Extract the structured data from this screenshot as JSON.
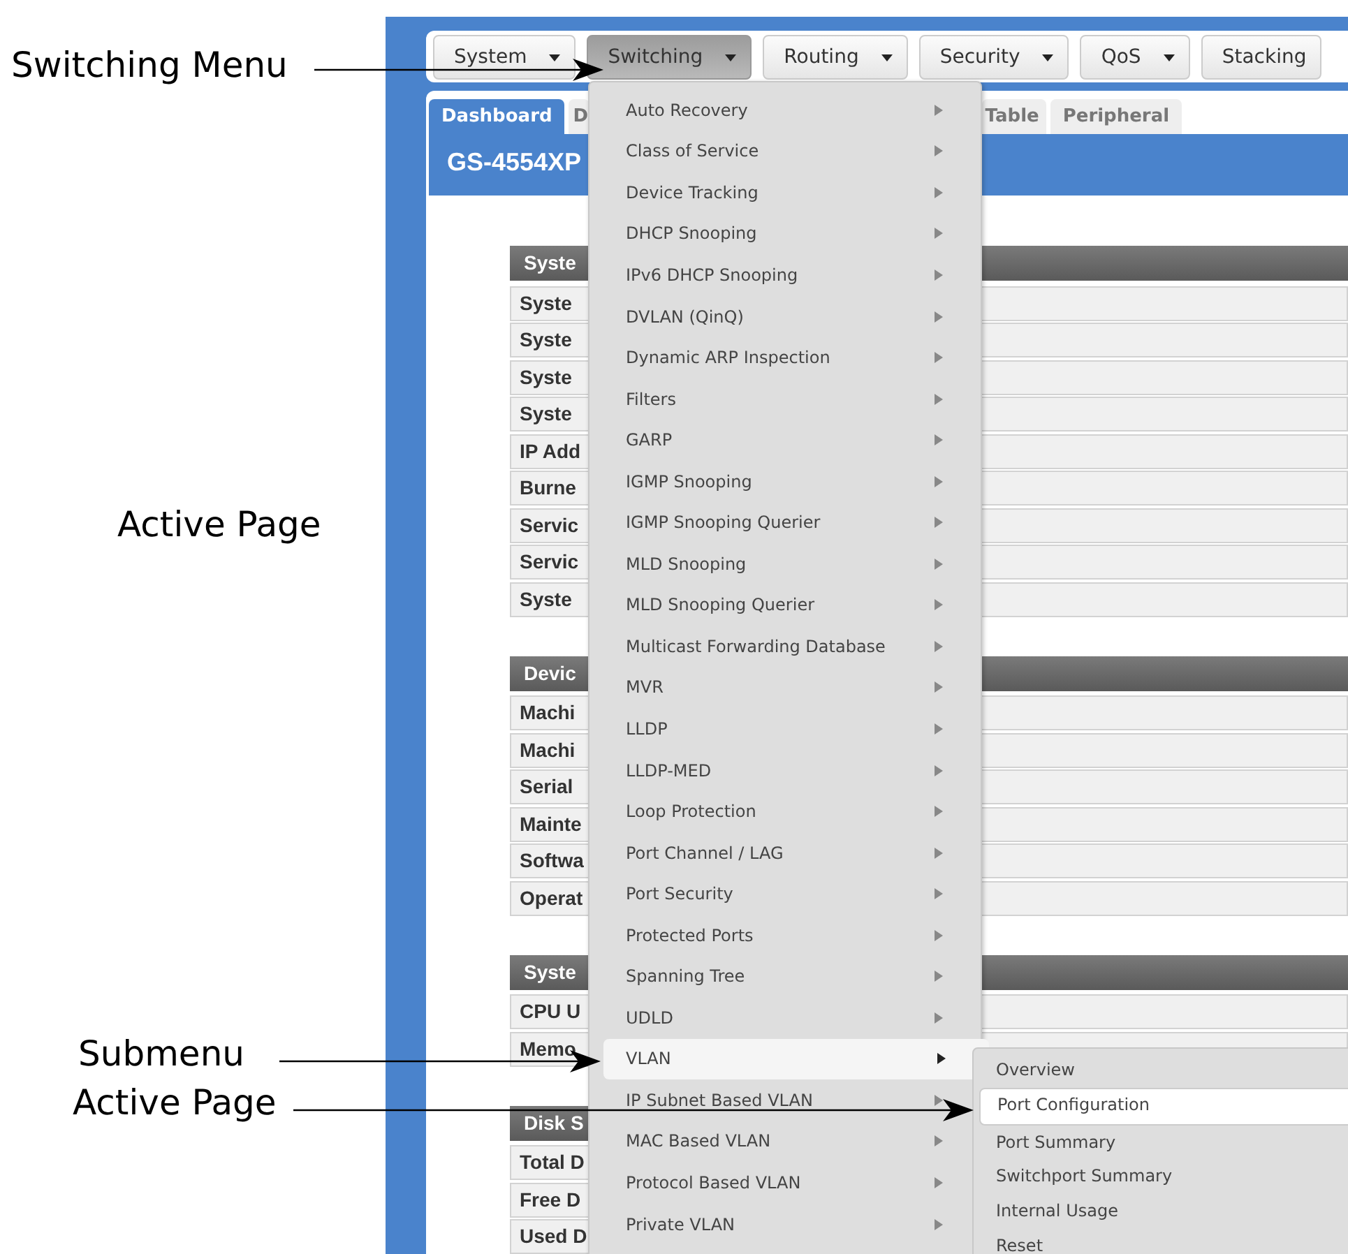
{
  "annotations": [
    {
      "label": "Switching Menu",
      "arrow": true
    },
    {
      "label": "Active Page",
      "arrow": false
    },
    {
      "label": "Submenu",
      "arrow": true
    },
    {
      "label": "Active Page",
      "arrow": true
    }
  ],
  "nav_menu": [
    {
      "label": "System",
      "selected": false,
      "caret": true
    },
    {
      "label": "Switching",
      "selected": true,
      "caret": true
    },
    {
      "label": "Routing",
      "selected": false,
      "caret": true
    },
    {
      "label": "Security",
      "selected": false,
      "caret": true
    },
    {
      "label": "QoS",
      "selected": false,
      "caret": true
    },
    {
      "label": "Stacking",
      "selected": false,
      "caret": false
    }
  ],
  "tabs": [
    {
      "label": "Dashboard",
      "selected": true
    },
    {
      "label": "D",
      "selected": false
    },
    {
      "label": "Table",
      "selected": false
    },
    {
      "label": "Peripheral",
      "selected": false
    }
  ],
  "page_title": "GS-4554XP",
  "sections": [
    {
      "title": "Syste",
      "rows": [
        "Syste",
        "Syste",
        "Syste",
        "Syste",
        "IP Add",
        "Burne",
        "Servic",
        "Servic",
        "Syste"
      ]
    },
    {
      "title": "Devic",
      "rows": [
        "Machi",
        "Machi",
        "Serial",
        "Mainte",
        "Softwa",
        "Operat"
      ]
    },
    {
      "title": "Syste",
      "rows": [
        "CPU U",
        "Memo"
      ]
    },
    {
      "title": "Disk S",
      "rows": [
        "Total D",
        "Free D",
        "Used D"
      ]
    }
  ],
  "dropdown": [
    {
      "label": "Auto Recovery",
      "selected": false,
      "submenu": true
    },
    {
      "label": "Class of Service",
      "selected": false,
      "submenu": true
    },
    {
      "label": "Device Tracking",
      "selected": false,
      "submenu": true
    },
    {
      "label": "DHCP Snooping",
      "selected": false,
      "submenu": true
    },
    {
      "label": "IPv6 DHCP Snooping",
      "selected": false,
      "submenu": true
    },
    {
      "label": "DVLAN (QinQ)",
      "selected": false,
      "submenu": true
    },
    {
      "label": "Dynamic ARP Inspection",
      "selected": false,
      "submenu": true
    },
    {
      "label": "Filters",
      "selected": false,
      "submenu": true
    },
    {
      "label": "GARP",
      "selected": false,
      "submenu": true
    },
    {
      "label": "IGMP Snooping",
      "selected": false,
      "submenu": true
    },
    {
      "label": "IGMP Snooping Querier",
      "selected": false,
      "submenu": true
    },
    {
      "label": "MLD Snooping",
      "selected": false,
      "submenu": true
    },
    {
      "label": "MLD Snooping Querier",
      "selected": false,
      "submenu": true
    },
    {
      "label": "Multicast Forwarding Database",
      "selected": false,
      "submenu": true
    },
    {
      "label": "MVR",
      "selected": false,
      "submenu": true
    },
    {
      "label": "LLDP",
      "selected": false,
      "submenu": true
    },
    {
      "label": "LLDP-MED",
      "selected": false,
      "submenu": true
    },
    {
      "label": "Loop Protection",
      "selected": false,
      "submenu": true
    },
    {
      "label": "Port Channel / LAG",
      "selected": false,
      "submenu": true
    },
    {
      "label": "Port Security",
      "selected": false,
      "submenu": true
    },
    {
      "label": "Protected Ports",
      "selected": false,
      "submenu": true
    },
    {
      "label": "Spanning Tree",
      "selected": false,
      "submenu": true
    },
    {
      "label": "UDLD",
      "selected": false,
      "submenu": true
    },
    {
      "label": "VLAN",
      "selected": true,
      "submenu": true
    },
    {
      "label": "IP Subnet Based VLAN",
      "selected": false,
      "submenu": true
    },
    {
      "label": "MAC Based VLAN",
      "selected": false,
      "submenu": true
    },
    {
      "label": "Protocol Based VLAN",
      "selected": false,
      "submenu": true
    },
    {
      "label": "Private VLAN",
      "selected": false,
      "submenu": true
    }
  ],
  "submenu": [
    {
      "label": "Overview",
      "selected": false
    },
    {
      "label": "Port Configuration",
      "selected": true
    },
    {
      "label": "Port Summary",
      "selected": false
    },
    {
      "label": "Switchport Summary",
      "selected": false
    },
    {
      "label": "Internal Usage",
      "selected": false
    },
    {
      "label": "Reset",
      "selected": false
    }
  ]
}
